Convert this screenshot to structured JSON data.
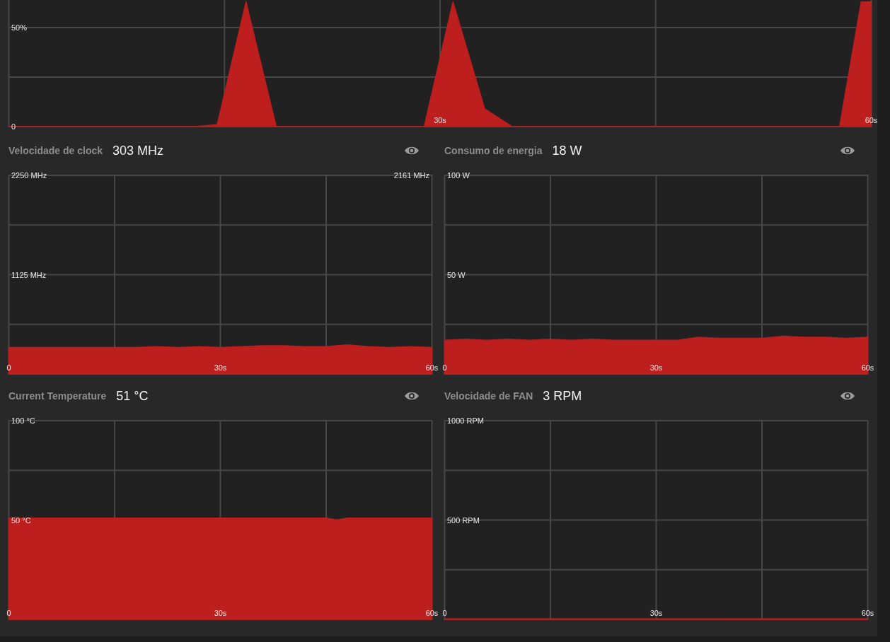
{
  "usage_chart": {
    "chart_data": {
      "type": "area",
      "x": [
        0,
        13,
        14.5,
        16.5,
        18.6,
        28.9,
        30.9,
        33.1,
        35,
        57.8,
        59.3,
        60
      ],
      "series": [
        {
          "color": "#bd1e1e",
          "values": [
            0,
            0,
            1,
            63,
            0,
            0,
            63,
            9,
            0,
            0,
            63,
            63
          ]
        }
      ],
      "ylim": [
        0,
        100
      ],
      "yticks": [
        {
          "value": 0,
          "label": "0"
        },
        {
          "value": 50,
          "label": "50%"
        }
      ],
      "xlim": [
        0,
        60
      ],
      "xticks": [
        {
          "value": 30,
          "label": "30s"
        },
        {
          "value": 60,
          "label": "60s"
        }
      ]
    }
  },
  "panels": [
    {
      "label": "Velocidade de clock",
      "value": "303 MHz",
      "chart_data": {
        "type": "area",
        "x": [
          0,
          3,
          6,
          9,
          12,
          15,
          18,
          21,
          24,
          27,
          30,
          33,
          36,
          39,
          42,
          45,
          48,
          51,
          54,
          57,
          60
        ],
        "series": [
          {
            "color": "#bd1e1e",
            "values": [
              300,
              300,
              300,
              300,
              300,
              300,
              300,
              310,
              300,
              310,
              300,
              310,
              320,
              320,
              310,
              310,
              330,
              310,
              300,
              310,
              300
            ]
          }
        ],
        "ylim": [
          0,
          2250
        ],
        "yticks": [
          {
            "value": 1125,
            "label": "1125 MHz"
          },
          {
            "value": 2250,
            "label": "2250 MHz"
          }
        ],
        "xlim": [
          0,
          60
        ],
        "xticks": [
          {
            "value": 0,
            "label": "0"
          },
          {
            "value": 30,
            "label": "30s"
          },
          {
            "value": 60,
            "label": "60s"
          }
        ],
        "annotations": [
          "2161 MHz"
        ]
      }
    },
    {
      "label": "Consumo de energia",
      "value": "18 W",
      "chart_data": {
        "type": "area",
        "x": [
          0,
          3,
          6,
          9,
          12,
          15,
          18,
          21,
          24,
          27,
          30,
          33,
          36,
          39,
          42,
          45,
          48,
          51,
          54,
          57,
          60
        ],
        "series": [
          {
            "color": "#bd1e1e",
            "values": [
              17,
              17.5,
              17,
              17.5,
              17,
              17.5,
              17,
              17.5,
              17,
              17,
              17,
              17,
              18.5,
              18,
              18,
              18,
              19,
              18.5,
              18.5,
              18,
              18.5
            ]
          }
        ],
        "ylim": [
          0,
          100
        ],
        "yticks": [
          {
            "value": 50,
            "label": "50 W"
          },
          {
            "value": 100,
            "label": "100 W"
          }
        ],
        "xlim": [
          0,
          60
        ],
        "xticks": [
          {
            "value": 0,
            "label": "0"
          },
          {
            "value": 30,
            "label": "30s"
          },
          {
            "value": 60,
            "label": "60s"
          }
        ]
      }
    },
    {
      "label": "Current Temperature",
      "value": "51 °C",
      "chart_data": {
        "type": "area",
        "x": [
          0,
          3,
          6,
          9,
          12,
          15,
          18,
          21,
          24,
          27,
          30,
          33,
          36,
          39,
          42,
          45,
          46.5,
          48,
          51,
          54,
          57,
          60
        ],
        "series": [
          {
            "color": "#bd1e1e",
            "values": [
              51,
              51,
              51,
              51,
              51,
              51,
              51,
              51,
              51,
              51,
              51,
              51,
              51,
              51,
              51,
              51,
              50,
              51,
              51,
              51,
              51,
              51
            ]
          }
        ],
        "ylim": [
          0,
          100
        ],
        "yticks": [
          {
            "value": 50,
            "label": "50 °C"
          },
          {
            "value": 100,
            "label": "100 °C"
          }
        ],
        "xlim": [
          0,
          60
        ],
        "xticks": [
          {
            "value": 0,
            "label": "0"
          },
          {
            "value": 30,
            "label": "30s"
          },
          {
            "value": 60,
            "label": "60s"
          }
        ]
      }
    },
    {
      "label": "Velocidade de FAN",
      "value": "3 RPM",
      "chart_data": {
        "type": "area",
        "x": [
          0,
          15,
          30,
          45,
          60
        ],
        "series": [
          {
            "color": "#bd1e1e",
            "values": [
              3,
              3,
              3,
              3,
              3
            ]
          }
        ],
        "ylim": [
          0,
          1000
        ],
        "yticks": [
          {
            "value": 500,
            "label": "500 RPM"
          },
          {
            "value": 1000,
            "label": "1000 RPM"
          }
        ],
        "xlim": [
          0,
          60
        ],
        "xticks": [
          {
            "value": 0,
            "label": "0"
          },
          {
            "value": 30,
            "label": "30s"
          },
          {
            "value": 60,
            "label": "60s"
          }
        ]
      }
    }
  ]
}
